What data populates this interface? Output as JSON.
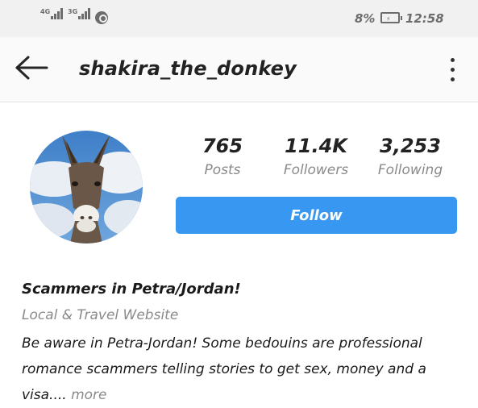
{
  "status_bar": {
    "network_1": "4G",
    "network_2": "3G",
    "battery_percent": "8%",
    "time": "12:58"
  },
  "header": {
    "username": "shakira_the_donkey",
    "back_icon": "arrow-left-icon",
    "menu_icon": "more-vertical-icon"
  },
  "profile": {
    "stats": [
      {
        "value": "765",
        "label": "Posts"
      },
      {
        "value": "11.4K",
        "label": "Followers"
      },
      {
        "value": "3,253",
        "label": "Following"
      }
    ],
    "follow_label": "Follow",
    "follow_color": "#3897f0"
  },
  "bio": {
    "name": "Scammers in Petra/Jordan!",
    "category": "Local & Travel Website",
    "text": "Be aware in Petra-Jordan! Some bedouins are professional romance scammers telling stories to get sex, money and a visa....",
    "more_label": "more"
  }
}
